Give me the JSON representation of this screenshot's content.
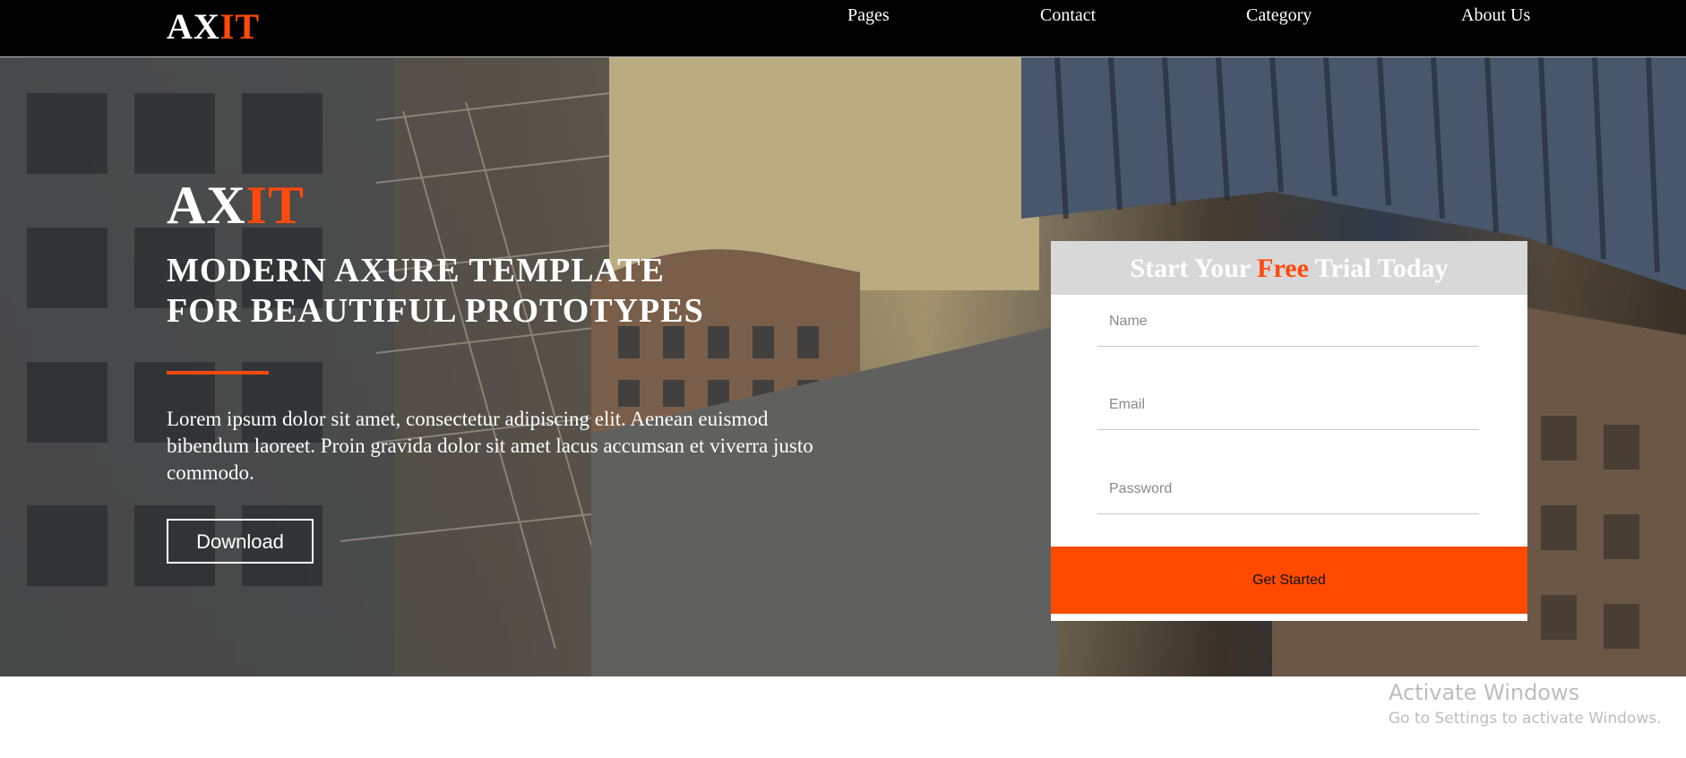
{
  "header": {
    "logo_main": "AX",
    "logo_accent": "IT",
    "nav": [
      {
        "label": "Pages"
      },
      {
        "label": "Contact"
      },
      {
        "label": "Category"
      },
      {
        "label": "About Us"
      }
    ]
  },
  "hero": {
    "brand_main": "AX",
    "brand_accent": "IT",
    "headline_line1": "MODERN AXURE TEMPLATE",
    "headline_line2": "FOR BEAUTIFUL PROTOTYPES",
    "paragraph": "Lorem ipsum dolor sit amet, consectetur adipiscing elit. Aenean euismod bibendum laoreet. Proin gravida dolor sit amet lacus accumsan et viverra justo commodo.",
    "download_label": "Download"
  },
  "form": {
    "title_pre": "Start Your ",
    "title_accent": "Free",
    "title_post": " Trial Today",
    "name_placeholder": "Name",
    "email_placeholder": "Email",
    "password_placeholder": "Password",
    "submit_label": "Get Started"
  },
  "watermark": {
    "title": "Activate Windows",
    "subtitle": "Go to Settings to activate Windows."
  },
  "colors": {
    "accent": "#ff4a0b",
    "nav_background": "#000000",
    "card_header": "#d8d8d8"
  }
}
